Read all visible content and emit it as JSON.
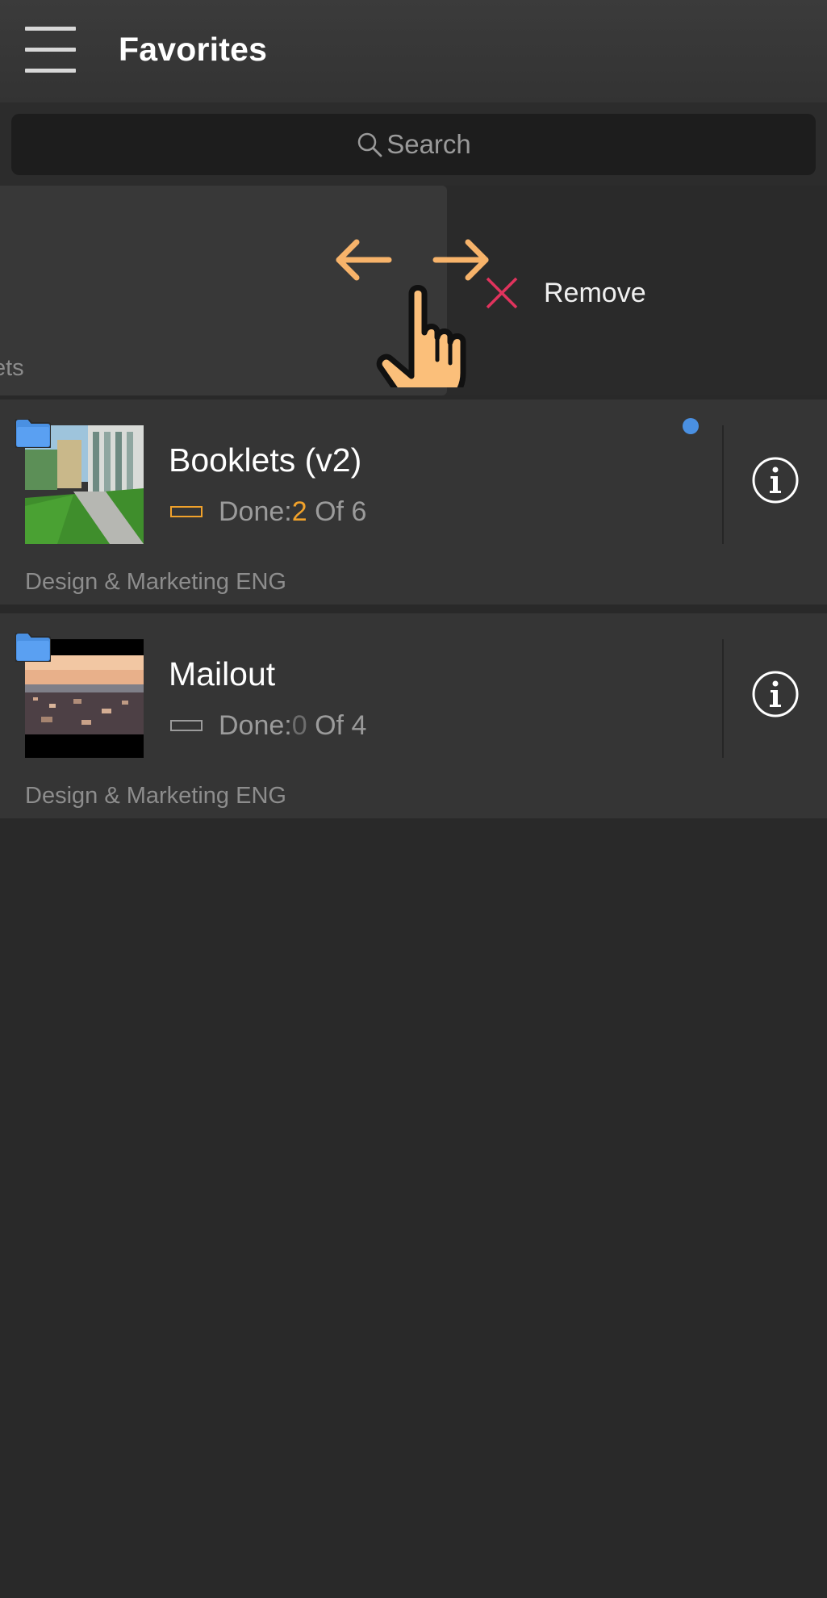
{
  "header": {
    "title": "Favorites",
    "menu_icon": "hamburger-menu-icon"
  },
  "search": {
    "placeholder": "Search",
    "icon": "search-icon"
  },
  "swiped_row": {
    "subtitle_partial": "klets",
    "action_label": "Remove",
    "action_icon": "close-x-icon",
    "action_color": "#e0335d",
    "gesture_icon": "swipe-hand-gesture-icon",
    "gesture_color": "#f7b36a"
  },
  "items": [
    {
      "title": "Booklets (v2)",
      "progress_label": "Done: ",
      "done": "2",
      "of_label": " Of ",
      "total": "6",
      "subtitle": "Design & Marketing ENG",
      "unread": true,
      "bar_color": "#f1a22b",
      "thumb": "building-courtyard-photo"
    },
    {
      "title": "Mailout",
      "progress_label": "Done: ",
      "done": "0",
      "of_label": " Of ",
      "total": "4",
      "subtitle": "Design & Marketing ENG",
      "unread": false,
      "bar_color": "#9b9b9b",
      "thumb": "city-skyline-photo"
    }
  ],
  "colors": {
    "background": "#292929",
    "header": "#363636",
    "card": "#353535",
    "accent_orange": "#f1a22b",
    "folder_blue": "#4a90e2",
    "unread_dot": "#4a90e2"
  }
}
